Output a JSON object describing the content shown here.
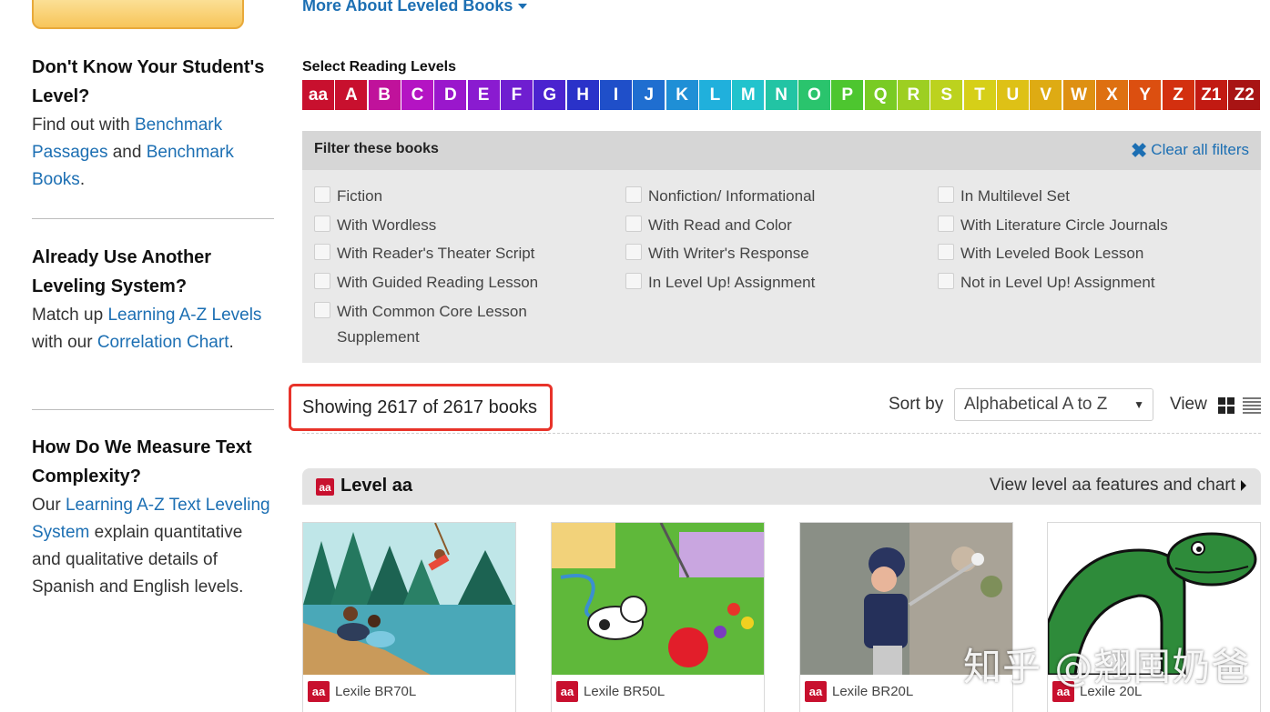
{
  "sidebar": {
    "sections": [
      {
        "heading": "Don't Know Your Student's Level?",
        "text_before": "Find out with ",
        "link1": "Benchmark Passages",
        "text_mid": " and ",
        "link2": "Benchmark Books",
        "text_after": "."
      },
      {
        "heading": "Already Use Another Leveling System?",
        "text_before": "Match up ",
        "link1": "Learning A-Z Levels",
        "text_mid": " with our ",
        "link2": "Correlation Chart",
        "text_after": "."
      },
      {
        "heading": "How Do We Measure Text Complexity?",
        "text_before": "Our ",
        "link1": "Learning A-Z Text Leveling System",
        "text_mid": " explain quantitative and qualitative details of Spanish and English levels.",
        "link2": "",
        "text_after": ""
      }
    ]
  },
  "header": {
    "more_about": "More About Leveled Books"
  },
  "reading_levels": {
    "title": "Select Reading Levels",
    "levels": [
      {
        "label": "aa",
        "color": "#c8102e"
      },
      {
        "label": "A",
        "color": "#c8102e"
      },
      {
        "label": "B",
        "color": "#c0129b"
      },
      {
        "label": "C",
        "color": "#b414c3"
      },
      {
        "label": "D",
        "color": "#9a17cc"
      },
      {
        "label": "E",
        "color": "#8a1bd0"
      },
      {
        "label": "F",
        "color": "#6f1ed0"
      },
      {
        "label": "G",
        "color": "#4b23cf"
      },
      {
        "label": "H",
        "color": "#2a32c9"
      },
      {
        "label": "I",
        "color": "#1f4fc9"
      },
      {
        "label": "J",
        "color": "#1f6ed0"
      },
      {
        "label": "K",
        "color": "#1f8fd6"
      },
      {
        "label": "L",
        "color": "#20b0dc"
      },
      {
        "label": "M",
        "color": "#22c3cd"
      },
      {
        "label": "N",
        "color": "#22c4a4"
      },
      {
        "label": "O",
        "color": "#2ac46d"
      },
      {
        "label": "P",
        "color": "#4dc62f"
      },
      {
        "label": "Q",
        "color": "#79cb24"
      },
      {
        "label": "R",
        "color": "#9dcf22"
      },
      {
        "label": "S",
        "color": "#bcd21e"
      },
      {
        "label": "T",
        "color": "#d6cf18"
      },
      {
        "label": "U",
        "color": "#dec116"
      },
      {
        "label": "V",
        "color": "#deab13"
      },
      {
        "label": "W",
        "color": "#de9012"
      },
      {
        "label": "X",
        "color": "#de7011"
      },
      {
        "label": "Y",
        "color": "#dc4f10"
      },
      {
        "label": "Z",
        "color": "#d3300f"
      },
      {
        "label": "Z1",
        "color": "#c21a12"
      },
      {
        "label": "Z2",
        "color": "#a81414"
      }
    ]
  },
  "filters": {
    "title": "Filter these books",
    "clear": "Clear all filters",
    "col1": [
      "Fiction",
      "With Wordless",
      "With Reader's Theater Script",
      "With Guided Reading Lesson",
      "With Common Core Lesson Supplement"
    ],
    "col2": [
      "Nonfiction/ Informational",
      "With Read and Color",
      "With Writer's Response",
      "In Level Up! Assignment"
    ],
    "col3": [
      "In Multilevel Set",
      "With Literature Circle Journals",
      "With Leveled Book Lesson",
      "Not in Level Up! Assignment"
    ]
  },
  "results": {
    "showing": "Showing 2617 of 2617 books",
    "sort_label": "Sort by",
    "sort_value": "Alphabetical A to Z",
    "view_label": "View"
  },
  "level_section": {
    "badge": "aa",
    "title": "Level aa",
    "link": "View level aa features and chart"
  },
  "books": [
    {
      "badge": "aa",
      "lexile": "Lexile BR70L"
    },
    {
      "badge": "aa",
      "lexile": "Lexile BR50L"
    },
    {
      "badge": "aa",
      "lexile": "Lexile BR20L"
    },
    {
      "badge": "aa",
      "lexile": "Lexile 20L"
    }
  ],
  "watermark": "知乎 @翘囤奶爸",
  "colors": {
    "link": "#1c6fb3",
    "accent_red": "#c8102e",
    "highlight_border": "#e8332a"
  }
}
